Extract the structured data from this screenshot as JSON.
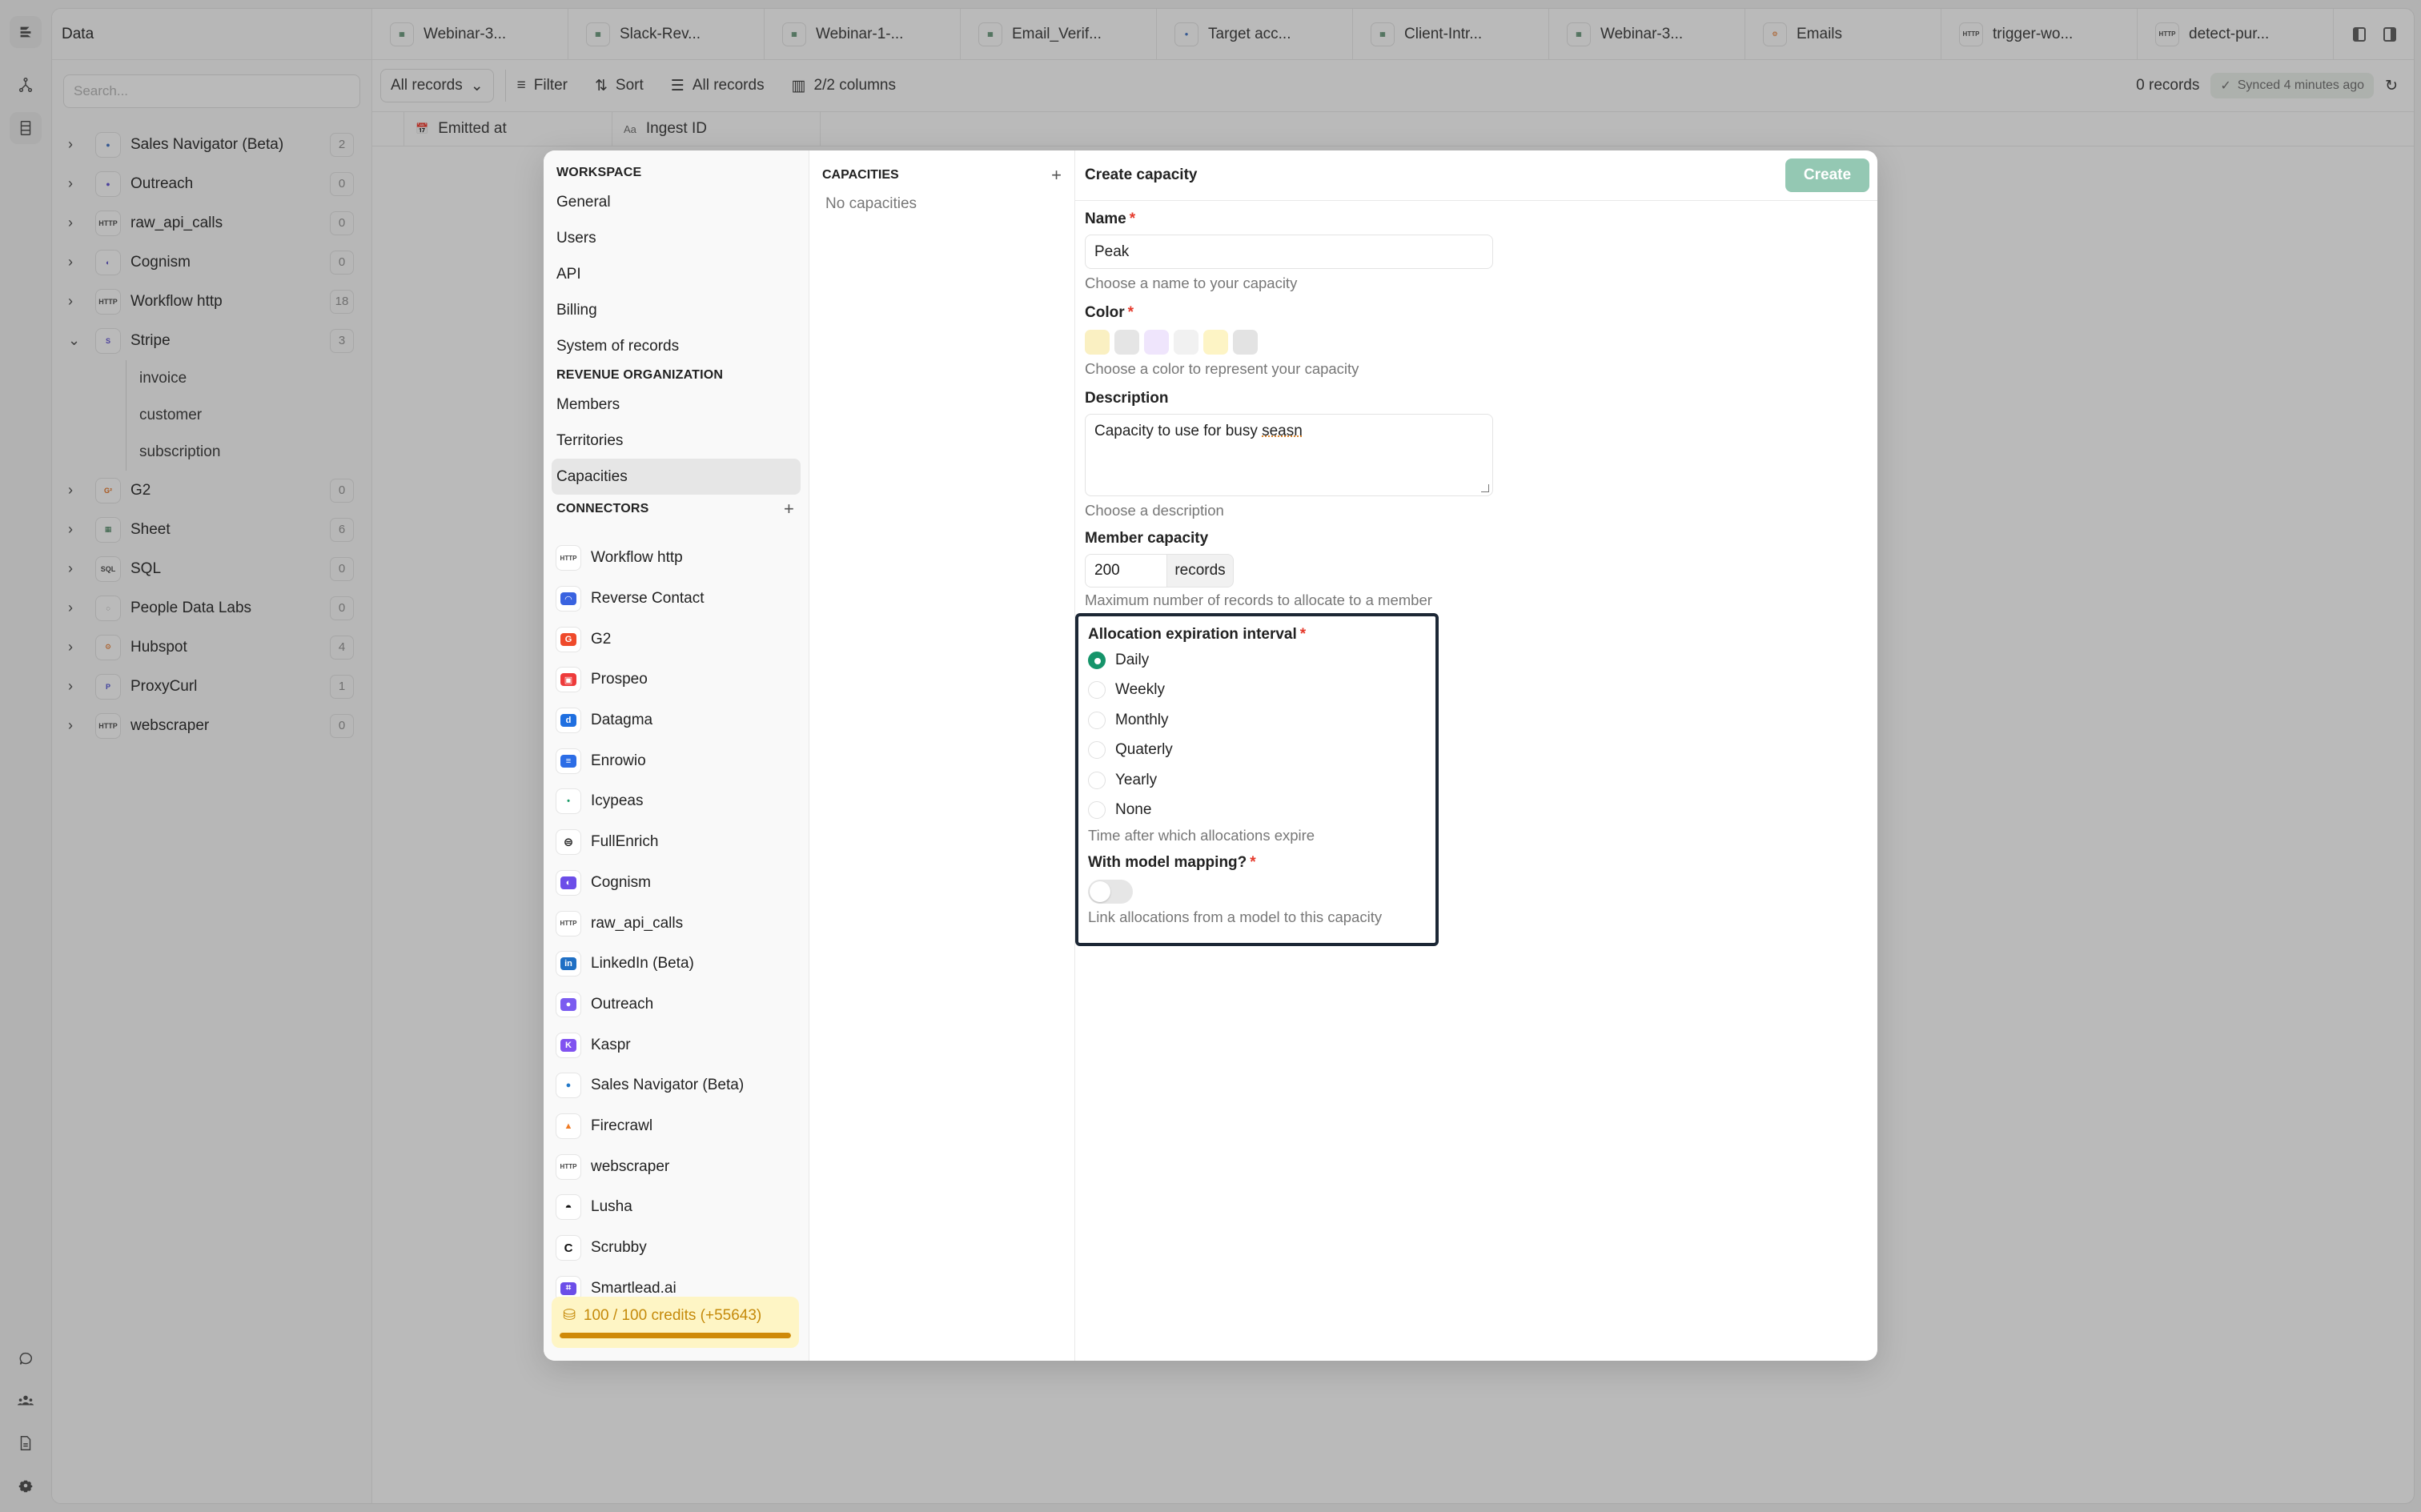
{
  "app": {
    "section_title": "Data",
    "search_placeholder": "Search...",
    "tabs": [
      {
        "label": "Webinar-3...",
        "icon": "sheet"
      },
      {
        "label": "Slack-Rev...",
        "icon": "sheet"
      },
      {
        "label": "Webinar-1-...",
        "icon": "sheet"
      },
      {
        "label": "Email_Verif...",
        "icon": "sheet"
      },
      {
        "label": "Target acc...",
        "icon": "sales-navigator"
      },
      {
        "label": "Client-Intr...",
        "icon": "sheet"
      },
      {
        "label": "Webinar-3...",
        "icon": "sheet"
      },
      {
        "label": "Emails",
        "icon": "hubspot"
      },
      {
        "label": "trigger-wo...",
        "icon": "http"
      },
      {
        "label": "detect-pur...",
        "icon": "http"
      }
    ],
    "toolbar": {
      "view_select": "All records",
      "filter": "Filter",
      "sort": "Sort",
      "view": "All records",
      "columns": "2/2 columns",
      "record_count": "0 records",
      "sync_status": "Synced 4 minutes ago"
    },
    "columns": [
      {
        "label": "Emitted at",
        "icon": "calendar"
      },
      {
        "label": "Ingest ID",
        "icon": "text"
      }
    ],
    "tree": [
      {
        "label": "Sales Navigator (Beta)",
        "count": "2",
        "icon": "sales-navigator",
        "expanded": false
      },
      {
        "label": "Outreach",
        "count": "0",
        "icon": "outreach",
        "expanded": false
      },
      {
        "label": "raw_api_calls",
        "count": "0",
        "icon": "http",
        "expanded": false
      },
      {
        "label": "Cognism",
        "count": "0",
        "icon": "cognism",
        "expanded": false
      },
      {
        "label": "Workflow http",
        "count": "18",
        "icon": "http",
        "expanded": false
      },
      {
        "label": "Stripe",
        "count": "3",
        "icon": "stripe",
        "expanded": true,
        "children": [
          "invoice",
          "customer",
          "subscription"
        ]
      },
      {
        "label": "G2",
        "count": "0",
        "icon": "g2",
        "expanded": false
      },
      {
        "label": "Sheet",
        "count": "6",
        "icon": "sheet",
        "expanded": false
      },
      {
        "label": "SQL",
        "count": "0",
        "icon": "sql",
        "expanded": false
      },
      {
        "label": "People Data Labs",
        "count": "0",
        "icon": "brain",
        "expanded": false
      },
      {
        "label": "Hubspot",
        "count": "4",
        "icon": "hubspot",
        "expanded": false
      },
      {
        "label": "ProxyCurl",
        "count": "1",
        "icon": "proxycurl",
        "expanded": false
      },
      {
        "label": "webscraper",
        "count": "0",
        "icon": "http",
        "expanded": false
      }
    ]
  },
  "settings": {
    "workspace_heading": "WORKSPACE",
    "workspace_items": [
      "General",
      "Users",
      "API",
      "Billing",
      "System of records"
    ],
    "revenue_heading": "REVENUE ORGANIZATION",
    "revenue_items": [
      "Members",
      "Territories",
      "Capacities"
    ],
    "active_item": "Capacities",
    "connectors_heading": "CONNECTORS",
    "connectors": [
      {
        "label": "Workflow http",
        "icon": "http",
        "color": "#ffffff"
      },
      {
        "label": "Reverse Contact",
        "icon": "reverse-contact",
        "color": "#3a63e0"
      },
      {
        "label": "G2",
        "icon": "g2",
        "color": "#ef4a2b"
      },
      {
        "label": "Prospeo",
        "icon": "prospeo",
        "color": "#ee3b3b"
      },
      {
        "label": "Datagma",
        "icon": "datagma",
        "color": "#1f6fe0"
      },
      {
        "label": "Enrowio",
        "icon": "enrowio",
        "color": "#2c6de6"
      },
      {
        "label": "Icypeas",
        "icon": "icypeas",
        "color": "#1e9d6a"
      },
      {
        "label": "FullEnrich",
        "icon": "fullenrich",
        "color": "#222222"
      },
      {
        "label": "Cognism",
        "icon": "cognism",
        "color": "#6c4ee8"
      },
      {
        "label": "raw_api_calls",
        "icon": "http",
        "color": "#ffffff"
      },
      {
        "label": "LinkedIn (Beta)",
        "icon": "linkedin",
        "color": "#1f6fc4"
      },
      {
        "label": "Outreach",
        "icon": "outreach",
        "color": "#7b5cf0"
      },
      {
        "label": "Kaspr",
        "icon": "kaspr",
        "color": "#8052f0"
      },
      {
        "label": "Sales Navigator (Beta)",
        "icon": "sales-navigator",
        "color": "#2278c8"
      },
      {
        "label": "Firecrawl",
        "icon": "firecrawl",
        "color": "#f07a22"
      },
      {
        "label": "webscraper",
        "icon": "http",
        "color": "#ffffff"
      },
      {
        "label": "Lusha",
        "icon": "lusha",
        "color": "#111111"
      },
      {
        "label": "Scrubby",
        "icon": "scrubby",
        "color": "#111111"
      },
      {
        "label": "Smartlead.ai",
        "icon": "smartlead",
        "color": "#6c4ee8"
      }
    ],
    "credits": {
      "label": "100 / 100 credits (+55643)",
      "used": 100,
      "total": 100,
      "progress": 1.0
    }
  },
  "capacities": {
    "heading": "CAPACITIES",
    "empty_text": "No capacities"
  },
  "form": {
    "title": "Create capacity",
    "create_label": "Create",
    "name": {
      "label": "Name",
      "value": "Peak",
      "help": "Choose a name to your capacity",
      "required": true
    },
    "color": {
      "label": "Color",
      "help": "Choose a color to represent your capacity",
      "required": true,
      "swatches": [
        "#faf0c2",
        "#e5e5e5",
        "#efe5fc",
        "#f1f1f1",
        "#fdf4c5",
        "#e3e3e3"
      ]
    },
    "description": {
      "label": "Description",
      "value_prefix": "Capacity to use for busy ",
      "value_misspelled": "seasn",
      "help": "Choose a description"
    },
    "member_capacity": {
      "label": "Member capacity",
      "value": "200",
      "suffix": "records",
      "help": "Maximum number of records to allocate to a member"
    },
    "expiration": {
      "label": "Allocation expiration interval",
      "required": true,
      "options": [
        "Daily",
        "Weekly",
        "Monthly",
        "Quaterly",
        "Yearly",
        "None"
      ],
      "selected": "Daily",
      "help": "Time after which allocations expire"
    },
    "model_mapping": {
      "label": "With model mapping?",
      "required": true,
      "enabled": false,
      "help": "Link allocations from a model to this capacity"
    }
  },
  "colors": {
    "accent": "#16946a",
    "create_button": "#94c8b3",
    "required": "#e5392b",
    "credits_bg": "#fef5c5",
    "credits_text": "#c58a0b",
    "focus_outline": "#1c2735"
  }
}
